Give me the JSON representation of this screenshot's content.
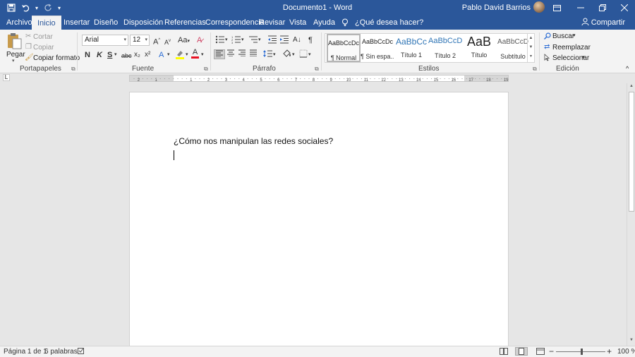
{
  "titlebar": {
    "document_title": "Documento1 - Word",
    "user_name": "Pablo David Barrios",
    "qat": {
      "save_icon": "save-icon",
      "undo_icon": "undo-icon",
      "redo_icon": "redo-icon",
      "customize_icon": "customize-icon"
    },
    "window_controls": [
      "ribbon-display-options-icon",
      "minimize-icon",
      "restore-icon",
      "close-icon"
    ]
  },
  "tabs": {
    "items": [
      "Archivo",
      "Inicio",
      "Insertar",
      "Diseño",
      "Disposición",
      "Referencias",
      "Correspondencia",
      "Revisar",
      "Vista",
      "Ayuda"
    ],
    "active": "Inicio",
    "tell_me": "¿Qué desea hacer?",
    "share": "Compartir"
  },
  "ribbon": {
    "clipboard": {
      "label": "Portapapeles",
      "paste": "Pegar",
      "cut": "Cortar",
      "copy": "Copiar",
      "format_painter": "Copiar formato"
    },
    "font": {
      "label": "Fuente",
      "font_name": "Arial",
      "font_size": "12",
      "grow": "A",
      "shrink": "A",
      "change_case": "Aa",
      "bold": "N",
      "italic": "K",
      "underline": "S",
      "strike": "abc",
      "subscript": "x₂",
      "superscript": "x²",
      "text_effects": "A",
      "font_color": "A",
      "highlight_color": "#ffff00",
      "font_color_value": "#e81123"
    },
    "paragraph": {
      "label": "Párrafo",
      "pilcrow": "¶"
    },
    "styles": {
      "label": "Estilos",
      "items": [
        {
          "preview": "AaBbCcDc",
          "name": "¶ Normal"
        },
        {
          "preview": "AaBbCcDc",
          "name": "¶ Sin espa..."
        },
        {
          "preview": "AaBbCc",
          "name": "Título 1"
        },
        {
          "preview": "AaBbCcD",
          "name": "Título 2"
        },
        {
          "preview": "AaB",
          "name": "Título"
        },
        {
          "preview": "AaBbCcD",
          "name": "Subtítulo"
        }
      ],
      "selected": "¶ Normal"
    },
    "editing": {
      "label": "Edición",
      "find": "Buscar",
      "replace": "Reemplazar",
      "select": "Seleccionar"
    }
  },
  "ruler": {
    "labels": [
      "2",
      "1",
      "1",
      "2",
      "3",
      "4",
      "5",
      "6",
      "7",
      "8",
      "9",
      "10",
      "11",
      "12",
      "13",
      "14",
      "15",
      "16",
      "17",
      "18",
      "19"
    ]
  },
  "document": {
    "text_line_1": "¿Cómo nos manipulan las redes sociales?"
  },
  "statusbar": {
    "page": "Página 1 de 1",
    "words": "6 palabras",
    "zoom": "100 %"
  },
  "colors": {
    "accent": "#2b579a",
    "ribbon_bg": "#f3f3f3",
    "workspace_bg": "#e6e6e6"
  }
}
